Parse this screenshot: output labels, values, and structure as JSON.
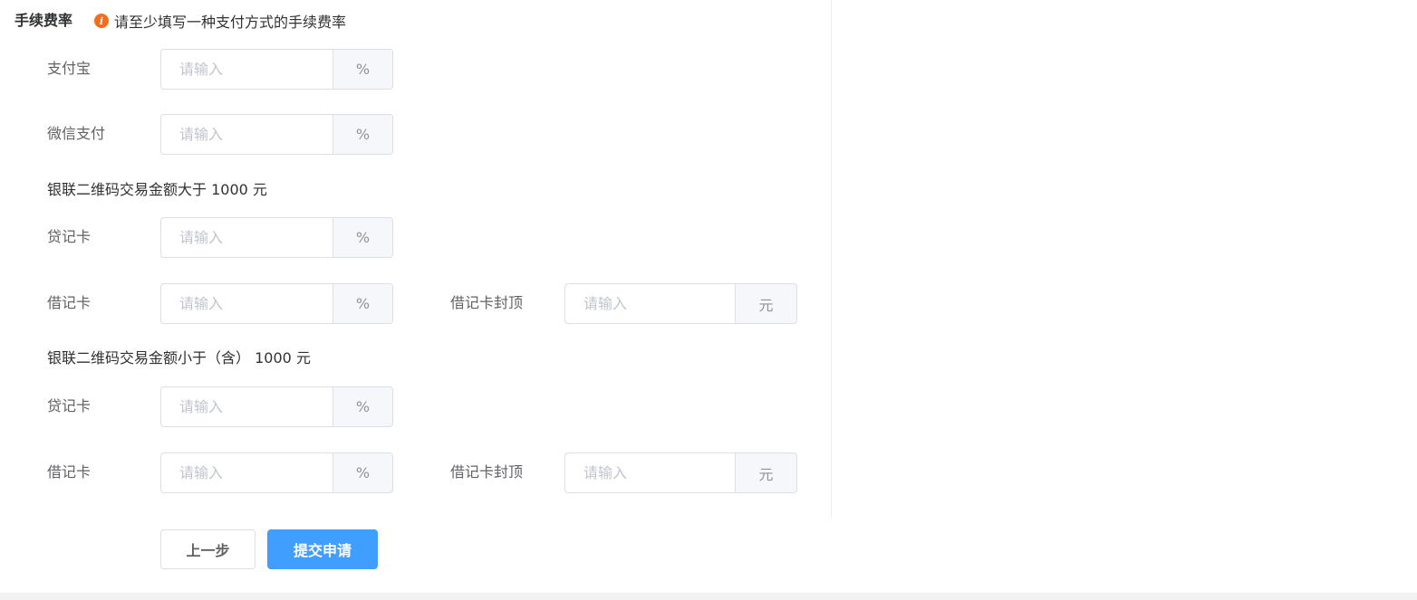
{
  "section": {
    "title": "手续费率",
    "tip": "请至少填写一种支付方式的手续费率"
  },
  "placeholder": "请输入",
  "units": {
    "percent": "%",
    "yuan": "元"
  },
  "rows": {
    "alipay_label": "支付宝",
    "wechat_label": "微信支付"
  },
  "group_over": {
    "heading": "银联二维码交易金额大于 1000 元",
    "credit_label": "贷记卡",
    "debit_label": "借记卡",
    "debit_cap_label": "借记卡封顶"
  },
  "group_under": {
    "heading": "银联二维码交易金额小于（含） 1000 元",
    "credit_label": "贷记卡",
    "debit_label": "借记卡",
    "debit_cap_label": "借记卡封顶"
  },
  "buttons": {
    "prev": "上一步",
    "submit": "提交申请"
  },
  "colors": {
    "accent": "#409eff",
    "tip_icon": "#f56c1b"
  },
  "icons": {
    "tip": "info-icon"
  }
}
